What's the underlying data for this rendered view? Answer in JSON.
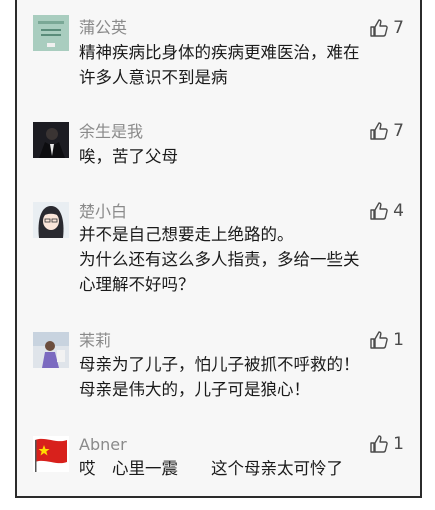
{
  "comments": [
    {
      "name": "蒲公英",
      "avatar_icon": "book-cover-avatar",
      "likes": "7",
      "text": "精神疾病比身体的疾病更难医治，难在\n许多人意识不到是病"
    },
    {
      "name": "余生是我",
      "avatar_icon": "suited-man-avatar",
      "likes": "7",
      "text": "唉，苦了父母"
    },
    {
      "name": "楚小白",
      "avatar_icon": "anime-girl-avatar",
      "likes": "4",
      "text": "并不是自己想要走上绝路的。\n为什么还有这么多人指责，多给一些关\n心理解不好吗？"
    },
    {
      "name": "茉莉",
      "avatar_icon": "woman-photo-avatar",
      "likes": "1",
      "text": "母亲为了儿子，怕儿子被抓不呼救的！\n母亲是伟大的，儿子可是狼心！"
    },
    {
      "name": "Abner",
      "avatar_icon": "flag-avatar",
      "likes": "1",
      "text": "哎　心里一震　　这个母亲太可怜了"
    }
  ],
  "colors": {
    "flag_red": "#d8211c",
    "flag_star": "#ffde00",
    "frame_bg": "#f7f7f7"
  }
}
